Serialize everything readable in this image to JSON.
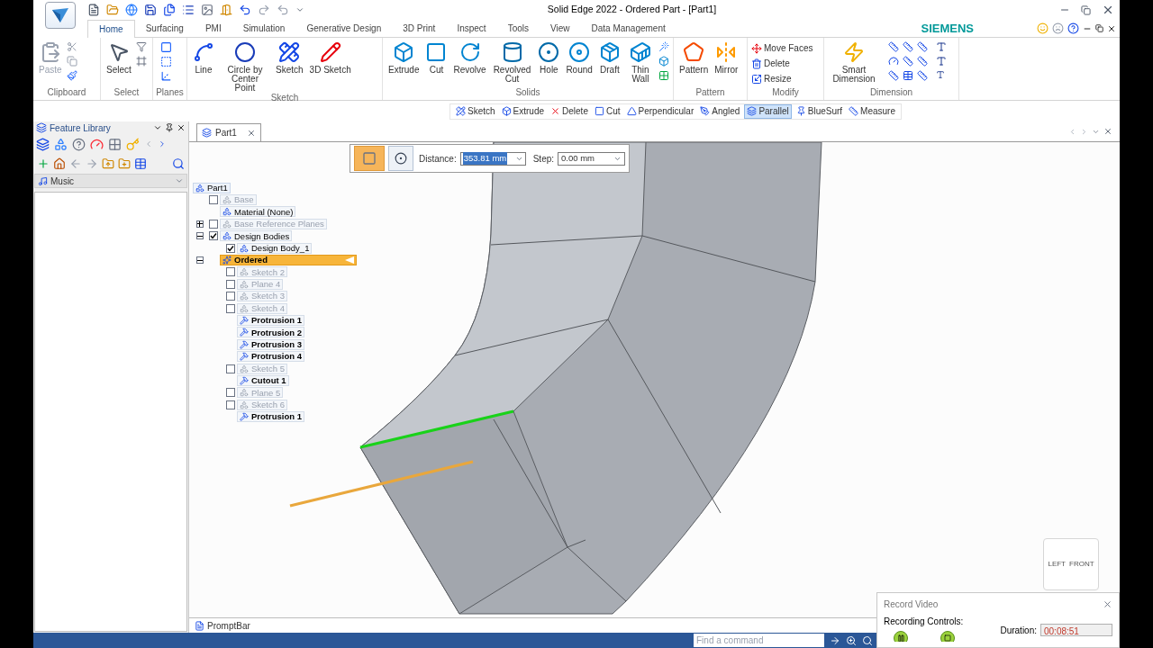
{
  "window": {
    "title": "Solid Edge 2022 - Ordered Part - [Part1]"
  },
  "ribbon_tabs": [
    {
      "label": "Home",
      "selected": true
    },
    {
      "label": "Surfacing",
      "selected": false
    },
    {
      "label": "PMI",
      "selected": false
    },
    {
      "label": "Simulation",
      "selected": false
    },
    {
      "label": "Generative Design",
      "selected": false
    },
    {
      "label": "3D Print",
      "selected": false
    },
    {
      "label": "Inspect",
      "selected": false
    },
    {
      "label": "Tools",
      "selected": false
    },
    {
      "label": "View",
      "selected": false
    },
    {
      "label": "Data Management",
      "selected": false
    }
  ],
  "brand": "SIEMENS",
  "ribbon_groups": [
    {
      "label": "Clipboard",
      "buttons": [
        {
          "label": "Paste",
          "kind": "large",
          "disabled": true
        }
      ]
    },
    {
      "label": "Select",
      "buttons": [
        {
          "label": "Select",
          "kind": "large",
          "disabled": false
        }
      ]
    },
    {
      "label": "Planes"
    },
    {
      "label": "Sketch",
      "buttons": [
        {
          "label": "Line",
          "kind": "large",
          "disabled": false
        },
        {
          "label": "Circle by Center Point",
          "kind": "large",
          "disabled": false
        },
        {
          "label": "Sketch",
          "kind": "large",
          "disabled": false
        },
        {
          "label": "3D Sketch",
          "kind": "large",
          "disabled": false
        }
      ]
    },
    {
      "label": "Solids",
      "buttons": [
        {
          "label": "Extrude",
          "kind": "large",
          "disabled": false
        },
        {
          "label": "Cut",
          "kind": "large",
          "disabled": false
        },
        {
          "label": "Revolve",
          "kind": "large",
          "disabled": false
        },
        {
          "label": "Revolved Cut",
          "kind": "large",
          "disabled": false
        },
        {
          "label": "Hole",
          "kind": "large",
          "disabled": false
        },
        {
          "label": "Round",
          "kind": "large",
          "disabled": false
        },
        {
          "label": "Draft",
          "kind": "large",
          "disabled": false
        },
        {
          "label": "Thin Wall",
          "kind": "large",
          "disabled": false
        }
      ]
    },
    {
      "label": "Pattern",
      "buttons": [
        {
          "label": "Pattern",
          "kind": "large",
          "disabled": false
        },
        {
          "label": "Mirror",
          "kind": "large",
          "disabled": false
        }
      ]
    },
    {
      "label": "Modify",
      "buttons": [
        {
          "label": "Move Faces",
          "kind": "small",
          "disabled": false
        },
        {
          "label": "Delete",
          "kind": "small",
          "disabled": false
        },
        {
          "label": "Resize",
          "kind": "small",
          "disabled": false
        }
      ]
    },
    {
      "label": "Dimension",
      "buttons": [
        {
          "label": "Smart Dimension",
          "kind": "large",
          "disabled": false
        }
      ]
    }
  ],
  "command_bar": [
    {
      "label": "Sketch",
      "selected": false
    },
    {
      "label": "Extrude",
      "selected": false
    },
    {
      "label": "Delete",
      "selected": false
    },
    {
      "label": "Cut",
      "selected": false
    },
    {
      "label": "Perpendicular",
      "selected": false
    },
    {
      "label": "Angled",
      "selected": false
    },
    {
      "label": "Parallel",
      "selected": true
    },
    {
      "label": "BlueSurf",
      "selected": false
    },
    {
      "label": "Measure",
      "selected": false
    }
  ],
  "document_tabs": [
    {
      "label": "Part1",
      "selected": true
    }
  ],
  "quickbar": {
    "modes": [
      {
        "selected": true
      },
      {
        "selected": false
      }
    ],
    "distance_label": "Distance:",
    "distance": "353.81 mm",
    "step_label": "Step:",
    "step": "0.00 mm"
  },
  "feature_library": {
    "title": "Feature Library",
    "folder": "Music"
  },
  "tree": {
    "label": "Part1",
    "kind": "root",
    "children": [
      {
        "label": "Base",
        "kind": "dim",
        "checked": false
      },
      {
        "label": "Material (None)",
        "kind": "normal"
      },
      {
        "label": "Base Reference Planes",
        "kind": "dim",
        "checked": false,
        "expanded": false
      },
      {
        "label": "Design Bodies",
        "kind": "normal",
        "checked": true,
        "expanded": true,
        "children": [
          {
            "label": "Design Body_1",
            "kind": "normal",
            "checked": true
          }
        ]
      },
      {
        "label": "Ordered",
        "kind": "group",
        "expanded": true,
        "children": [
          {
            "label": "Sketch 2",
            "kind": "dim",
            "checked": false
          },
          {
            "label": "Plane 4",
            "kind": "dim",
            "checked": false
          },
          {
            "label": "Sketch 3",
            "kind": "dim",
            "checked": false
          },
          {
            "label": "Sketch 4",
            "kind": "dim",
            "checked": false
          },
          {
            "label": "Protrusion 1",
            "kind": "bold"
          },
          {
            "label": "Protrusion 2",
            "kind": "bold"
          },
          {
            "label": "Protrusion 3",
            "kind": "bold"
          },
          {
            "label": "Protrusion 4",
            "kind": "bold"
          },
          {
            "label": "Sketch 5",
            "kind": "dim",
            "checked": false
          },
          {
            "label": "Cutout 1",
            "kind": "bold"
          },
          {
            "label": "Plane 5",
            "kind": "dim",
            "checked": false
          },
          {
            "label": "Sketch 6",
            "kind": "dim",
            "checked": false
          },
          {
            "label": "Protrusion 1",
            "kind": "bold"
          }
        ]
      }
    ]
  },
  "view_cube": {
    "faces": [
      "LEFT",
      "FRONT"
    ]
  },
  "prompt_bar": {
    "label": "PromptBar"
  },
  "status_bar": {
    "search_placeholder": "Find a command"
  },
  "record_dialog": {
    "title": "Record Video",
    "controls_label": "Recording Controls:",
    "duration_label": "Duration:",
    "duration": "00:08:51"
  }
}
